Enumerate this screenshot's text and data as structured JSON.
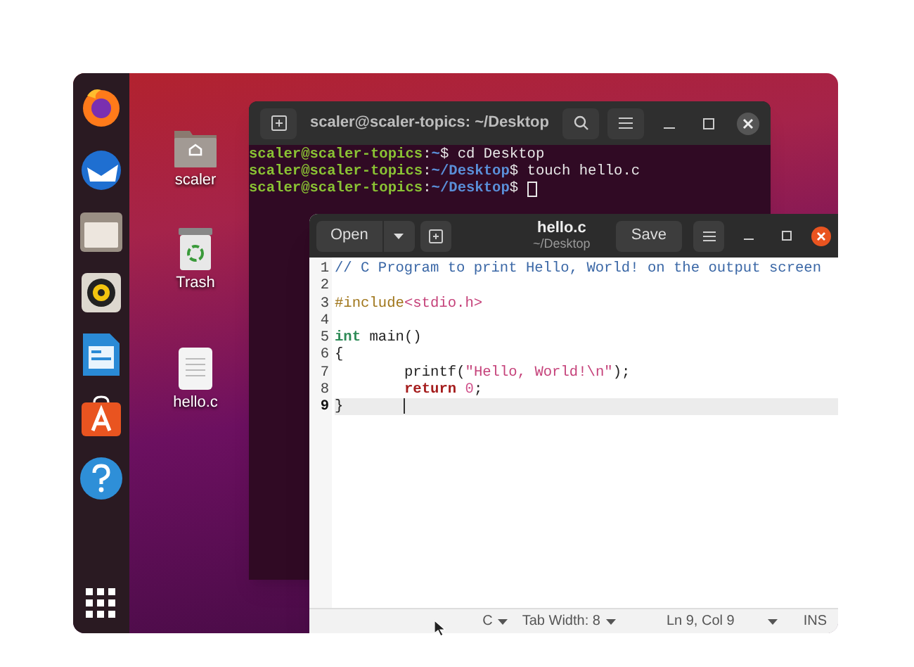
{
  "desktop_icons": [
    {
      "label": "scaler",
      "kind": "folder"
    },
    {
      "label": "Trash",
      "kind": "trash"
    },
    {
      "label": "hello.c",
      "kind": "file"
    }
  ],
  "terminal": {
    "title": "scaler@scaler-topics: ~/Desktop",
    "lines": [
      {
        "cursor": false,
        "segments": [
          {
            "text": "scaler@scaler-topics",
            "kind": "user"
          },
          {
            "text": ":",
            "kind": "plain"
          },
          {
            "text": "~",
            "kind": "path"
          },
          {
            "text": "$ cd Desktop",
            "kind": "plain"
          }
        ]
      },
      {
        "cursor": false,
        "segments": [
          {
            "text": "scaler@scaler-topics",
            "kind": "user"
          },
          {
            "text": ":",
            "kind": "plain"
          },
          {
            "text": "~/Desktop",
            "kind": "path"
          },
          {
            "text": "$ touch hello.c",
            "kind": "plain"
          }
        ]
      },
      {
        "cursor": true,
        "segments": [
          {
            "text": "scaler@scaler-topics",
            "kind": "user"
          },
          {
            "text": ":",
            "kind": "plain"
          },
          {
            "text": "~/Desktop",
            "kind": "path"
          },
          {
            "text": "$ ",
            "kind": "plain"
          }
        ]
      }
    ]
  },
  "editor": {
    "title": "hello.c",
    "subtitle": "~/Desktop",
    "open_label": "Open",
    "save_label": "Save",
    "lines": [
      {
        "number": "1",
        "selected": false,
        "tokens": [
          {
            "text": "// C Program to print Hello, World! on the output screen",
            "kind": "comment"
          }
        ]
      },
      {
        "number": "2",
        "selected": false
      },
      {
        "number": "3",
        "selected": false,
        "tokens": [
          {
            "text": "#include",
            "kind": "preproc"
          },
          {
            "text": "<stdio.h>",
            "kind": "string"
          }
        ]
      },
      {
        "number": "4",
        "selected": false
      },
      {
        "number": "5",
        "selected": false,
        "tokens": [
          {
            "text": "int",
            "kind": "type"
          },
          {
            "text": " main()",
            "kind": "plain"
          }
        ]
      },
      {
        "number": "6",
        "selected": false,
        "tokens": [
          {
            "text": "{",
            "kind": "plain"
          }
        ]
      },
      {
        "number": "7",
        "selected": false,
        "indented": true,
        "tokens": [
          {
            "text": "printf(",
            "kind": "plain"
          },
          {
            "text": "\"Hello, World!\\n\"",
            "kind": "string"
          },
          {
            "text": ");",
            "kind": "plain"
          }
        ]
      },
      {
        "number": "8",
        "selected": false,
        "indented": true,
        "tokens": [
          {
            "text": "return",
            "kind": "keyword"
          },
          {
            "text": " 0",
            "kind": "number"
          },
          {
            "text": ";",
            "kind": "plain"
          }
        ]
      },
      {
        "number": "9",
        "selected": true,
        "tokens": [
          {
            "text": "}",
            "kind": "plain"
          }
        ]
      }
    ],
    "status_bar": {
      "language": "C",
      "tab_width": "Tab Width: 8",
      "position": "Ln 9, Col 9",
      "mode": "INS"
    }
  }
}
